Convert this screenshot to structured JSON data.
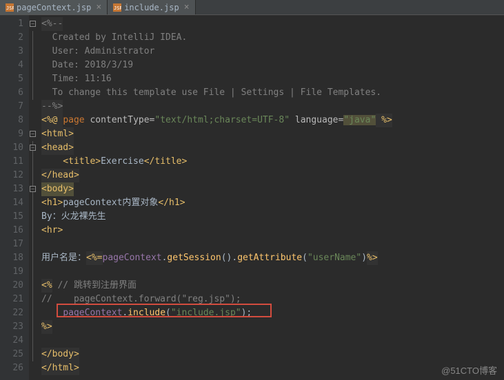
{
  "tabs": [
    {
      "label": "pageContext.jsp",
      "active": false
    },
    {
      "label": "include.jsp",
      "active": true
    }
  ],
  "lineNumbers": [
    "1",
    "2",
    "3",
    "4",
    "5",
    "6",
    "7",
    "8",
    "9",
    "10",
    "11",
    "12",
    "13",
    "14",
    "15",
    "16",
    "17",
    "18",
    "19",
    "20",
    "21",
    "22",
    "23",
    "24",
    "25",
    "26"
  ],
  "code": {
    "l1": {
      "open": "<%--"
    },
    "l2": {
      "text": "  Created by IntelliJ IDEA."
    },
    "l3": {
      "text": "  User: Administrator"
    },
    "l4": {
      "text": "  Date: 2018/3/19"
    },
    "l5": {
      "text": "  Time: 11:16"
    },
    "l6": {
      "text": "  To change this template use File | Settings | File Templates."
    },
    "l7": {
      "close": "--%>"
    },
    "l8": {
      "open": "<%@ ",
      "kw": "page",
      "a1": " contentType=",
      "s1": "\"text/html;charset=UTF-8\"",
      "a2": " language=",
      "s2": "\"java\"",
      "close": " %>"
    },
    "l9": {
      "tag": "<html>"
    },
    "l10": {
      "tag": "<head>"
    },
    "l11": {
      "t1": "    <title>",
      "text": "Exercise",
      "t2": "</title>"
    },
    "l12": {
      "tag": "</head>"
    },
    "l13": {
      "tag": "<body>"
    },
    "l14": {
      "t1": "<h1>",
      "text": "pageContext内置对象",
      "t2": "</h1>"
    },
    "l15": {
      "text": "By：火龙裸先生"
    },
    "l16": {
      "tag": "<hr>"
    },
    "l18": {
      "text": "用户名是：",
      "open": "<%=",
      "f1": "pageContext",
      "d1": ".",
      "m1": "getSession",
      "d2": "().",
      "m2": "getAttribute",
      "d3": "(",
      "s1": "\"userName\"",
      "d4": ")",
      "close": "%>"
    },
    "l20": {
      "open": "<%",
      "c1": " // 跳转到注册界面"
    },
    "l21": {
      "c1": "//    pageContext.forward(\"reg.jsp\");"
    },
    "l22": {
      "pad": "    ",
      "f1": "pageContext",
      "d1": ".",
      "m1": "include",
      "d2": "(",
      "s1": "\"include.jsp\"",
      "d3": ");"
    },
    "l23": {
      "close": "%>"
    },
    "l25": {
      "tag": "</body>"
    },
    "l26": {
      "tag": "</html>"
    }
  },
  "watermark": "@51CTO博客"
}
